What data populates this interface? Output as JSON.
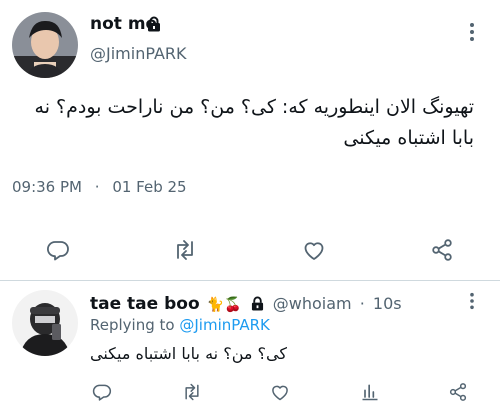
{
  "tweet": {
    "display_name": "not me",
    "handle": "@JiminPARK",
    "text": "تهیونگ الان اینطوریه که: کی؟ من؟ من ناراحت بودم؟ نه بابا اشتباه میکنی",
    "time": "09:36 PM",
    "separator": "·",
    "date": "01 Feb 25",
    "icons": {
      "lock": "lock-icon",
      "more": "more-vertical-icon",
      "reply": "reply-icon",
      "retweet": "retweet-icon",
      "like": "heart-icon",
      "share": "share-icon"
    }
  },
  "reply": {
    "display_name": "tae tae boo",
    "emoji": "🐈🍒",
    "handle": "@whoiam",
    "separator": "·",
    "age": "10s",
    "replying_prefix": "Replying to",
    "replying_handle": "@JiminPARK",
    "text": "کی؟ من؟ نه بابا اشتباه میکنی",
    "icons": {
      "lock": "lock-icon",
      "more": "more-vertical-icon",
      "reply": "reply-icon",
      "retweet": "retweet-icon",
      "like": "heart-icon",
      "views": "views-icon",
      "share": "share-icon"
    }
  },
  "colors": {
    "text": "#0f1419",
    "secondary": "#536471",
    "link": "#1d9bf0",
    "divider": "#cfd9de"
  }
}
